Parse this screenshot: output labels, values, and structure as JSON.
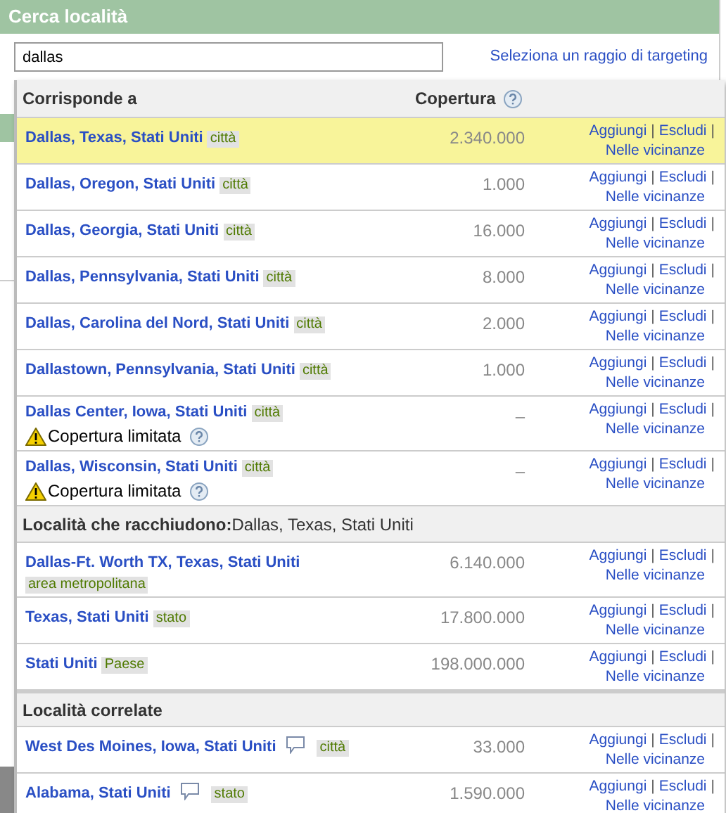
{
  "title": "Cerca località",
  "search": {
    "value": "dallas"
  },
  "radius_link": "Seleziona un raggio di targeting",
  "columns": [
    "Corrisponde a",
    "Copertura"
  ],
  "groups": [
    {
      "rows": [
        {
          "name": "Dallas, Texas, Stati Uniti",
          "type": "città",
          "coverage": "2.340.000",
          "selected": true,
          "note": false,
          "actions": [
            "Aggiungi",
            "|",
            "Escludi",
            "|",
            "Nelle vicinanze"
          ]
        },
        {
          "name": "Dallas, Oregon, Stati Uniti",
          "type": "città",
          "coverage": "1.000",
          "selected": false,
          "note": false,
          "actions": [
            "Aggiungi",
            "|",
            "Escludi",
            "|",
            "Nelle vicinanze"
          ]
        },
        {
          "name": "Dallas, Georgia, Stati Uniti",
          "type": "città",
          "coverage": "16.000",
          "selected": false,
          "note": false,
          "actions": [
            "Aggiungi",
            "|",
            "Escludi",
            "|",
            "Nelle vicinanze"
          ]
        },
        {
          "name": "Dallas, Pennsylvania, Stati Uniti",
          "type": "città",
          "coverage": "8.000",
          "selected": false,
          "note": false,
          "actions": [
            "Aggiungi",
            "|",
            "Escludi",
            "|",
            "Nelle vicinanze"
          ]
        },
        {
          "name": "Dallas, Carolina del Nord, Stati Uniti",
          "type": "città",
          "coverage": "2.000",
          "selected": false,
          "note": false,
          "actions": [
            "Aggiungi",
            "|",
            "Escludi",
            "|",
            "Nelle vicinanze"
          ]
        },
        {
          "name": "Dallastown, Pennsylvania, Stati Uniti",
          "type": "città",
          "coverage": "1.000",
          "selected": false,
          "note": false,
          "actions": [
            "Aggiungi",
            "|",
            "Escludi",
            "|",
            "Nelle vicinanze"
          ]
        },
        {
          "name": "Dallas Center, Iowa, Stati Uniti",
          "type": "città",
          "coverage": "–",
          "selected": false,
          "note": false,
          "warning": "Copertura limitata",
          "actions": [
            "Aggiungi",
            "|",
            "Escludi",
            "|",
            "Nelle vicinanze"
          ]
        },
        {
          "name": "Dallas, Wisconsin, Stati Uniti",
          "type": "città",
          "coverage": "–",
          "selected": false,
          "note": false,
          "warning": "Copertura limitata",
          "actions": [
            "Aggiungi",
            "|",
            "Escludi",
            "|",
            "Nelle vicinanze"
          ]
        }
      ]
    },
    {
      "heading": "**Località che racchiudono:**Dallas, Texas, Stati Uniti",
      "rows": [
        {
          "name": "Dallas-Ft. Worth TX, Texas, Stati Uniti",
          "type": "area metropolitana",
          "coverage": "6.140.000",
          "selected": false,
          "note": false,
          "actions": [
            "Aggiungi",
            "|",
            "Escludi",
            "|",
            "Nelle vicinanze"
          ]
        },
        {
          "name": "Texas, Stati Uniti",
          "type": "stato",
          "coverage": "17.800.000",
          "selected": false,
          "note": false,
          "actions": [
            "Aggiungi",
            "|",
            "Escludi",
            "|",
            "Nelle vicinanze"
          ]
        },
        {
          "name": "Stati Uniti",
          "type": "Paese",
          "coverage": "198.000.000",
          "selected": false,
          "note": false,
          "actions": [
            "Aggiungi",
            "|",
            "Escludi",
            "|",
            "Nelle vicinanze"
          ]
        }
      ]
    },
    {
      "heading": "**Località correlate**",
      "rows": [
        {
          "name": "West Des Moines, Iowa, Stati Uniti",
          "type": "città",
          "coverage": "33.000",
          "selected": false,
          "note": true,
          "actions": [
            "Aggiungi",
            "|",
            "Escludi",
            "|",
            "Nelle vicinanze"
          ]
        },
        {
          "name": "Alabama, Stati Uniti",
          "type": "stato",
          "coverage": "1.590.000",
          "selected": false,
          "note": true,
          "actions": [
            "Aggiungi",
            "|",
            "Escludi",
            "|",
            "Nelle vicinanze"
          ]
        }
      ]
    }
  ]
}
